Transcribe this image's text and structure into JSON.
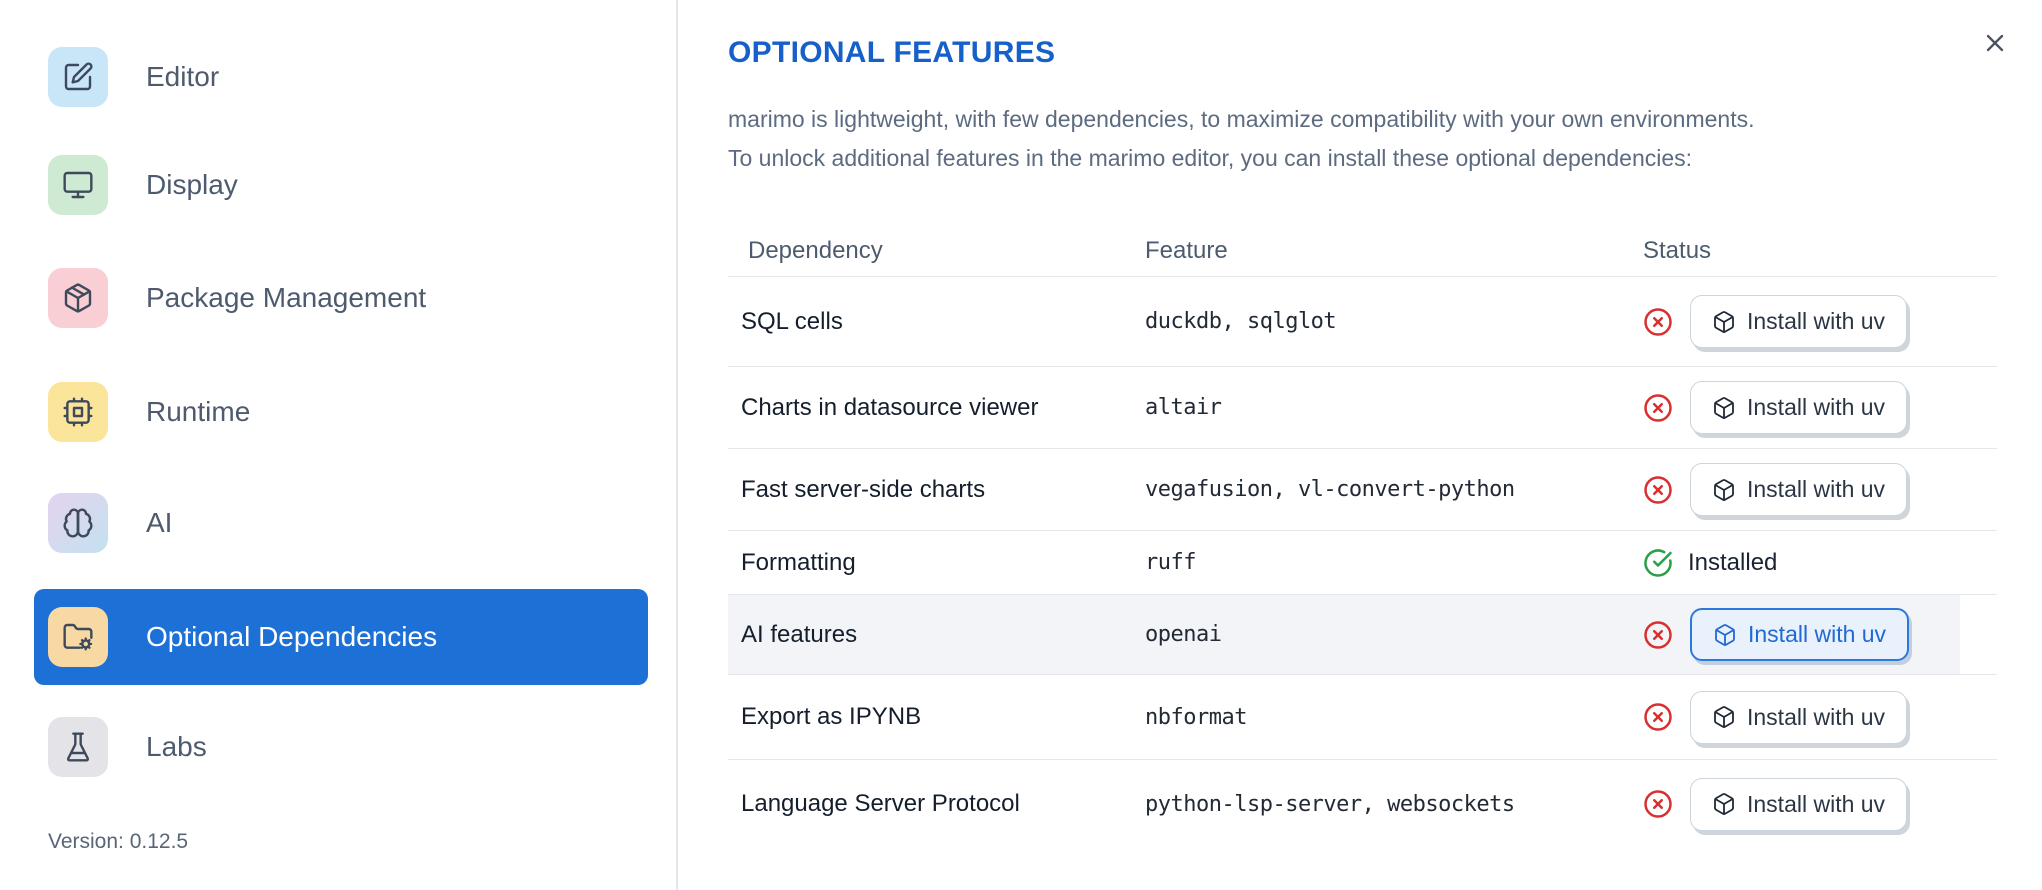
{
  "sidebar": {
    "items": [
      {
        "label": "Editor",
        "icon": "edit-icon",
        "icon_bg": "#c9e5f8"
      },
      {
        "label": "Display",
        "icon": "monitor-icon",
        "icon_bg": "#cfead2"
      },
      {
        "label": "Package Management",
        "icon": "package-icon",
        "icon_bg": "#f9ced4"
      },
      {
        "label": "Runtime",
        "icon": "cpu-icon",
        "icon_bg": "#fbe59b"
      },
      {
        "label": "AI",
        "icon": "brain-icon",
        "icon_bg": "linear-gradient(135deg,#e4d3ee 0%,#c4e1f0 100%)"
      },
      {
        "label": "Optional Dependencies",
        "icon": "folder-cog-icon",
        "icon_bg": "#f8d9a3",
        "selected": true
      },
      {
        "label": "Labs",
        "icon": "flask-icon",
        "icon_bg": "#e4e4e8"
      }
    ],
    "selected_bg": "#1d70d6",
    "version_label": "Version: 0.12.5"
  },
  "panel": {
    "title": "OPTIONAL FEATURES",
    "title_color": "#1660c9",
    "description_line1": "marimo is lightweight, with few dependencies, to maximize compatibility with your own environments.",
    "description_line2": "To unlock additional features in the marimo editor, you can install these optional dependencies:",
    "close_icon": "close-icon"
  },
  "table": {
    "headers": {
      "dependency": "Dependency",
      "feature": "Feature",
      "status": "Status"
    },
    "install_button_label": "Install with uv",
    "installed_label": "Installed",
    "status_colors": {
      "missing": "#d92f2f",
      "installed": "#27a048"
    },
    "rows": [
      {
        "dependency": "SQL cells",
        "feature": "duckdb, sqlglot",
        "status": "missing"
      },
      {
        "dependency": "Charts in datasource viewer",
        "feature": "altair",
        "status": "missing"
      },
      {
        "dependency": "Fast server-side charts",
        "feature": "vegafusion, vl-convert-python",
        "status": "missing"
      },
      {
        "dependency": "Formatting",
        "feature": "ruff",
        "status": "installed"
      },
      {
        "dependency": "AI features",
        "feature": "openai",
        "status": "missing",
        "highlighted": true
      },
      {
        "dependency": "Export as IPYNB",
        "feature": "nbformat",
        "status": "missing"
      },
      {
        "dependency": "Language Server Protocol",
        "feature": "python-lsp-server, websockets",
        "status": "missing"
      }
    ]
  }
}
